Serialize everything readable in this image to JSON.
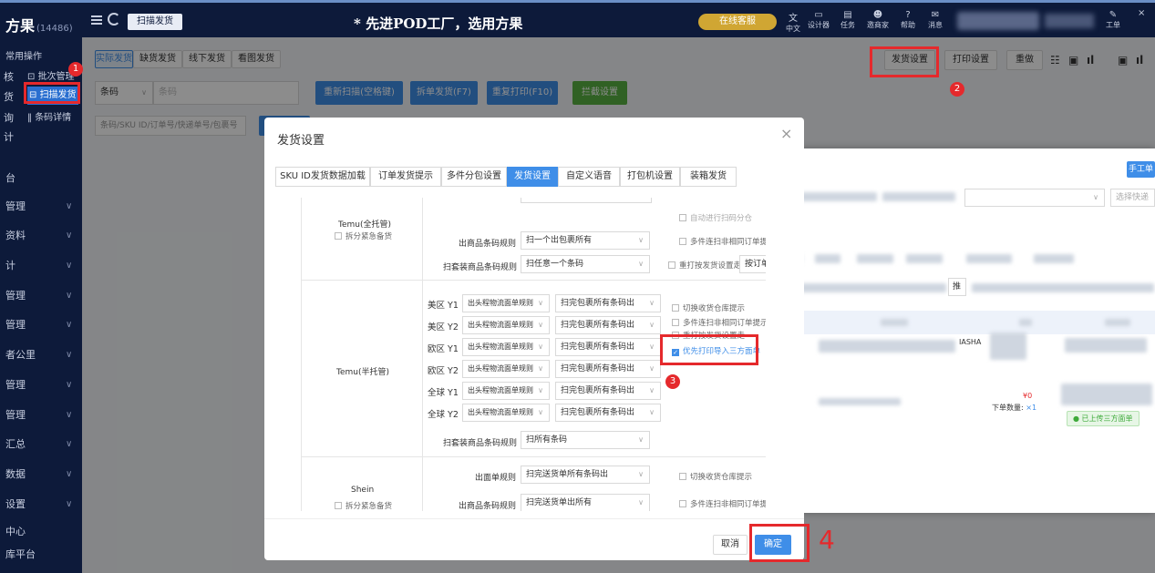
{
  "topbar": {
    "app_name": "方果",
    "app_count": "(14486)",
    "page_tab": "扫描发货",
    "slogan": "* 先进POD工厂，选用方果",
    "promo": "在线客服",
    "icons": [
      {
        "name": "translate-icon",
        "label": "中文"
      },
      {
        "name": "designer-icon",
        "label": "设计器"
      },
      {
        "name": "task-icon",
        "label": "任务"
      },
      {
        "name": "invite-icon",
        "label": "邀商家"
      },
      {
        "name": "help-icon",
        "label": "帮助"
      },
      {
        "name": "message-icon",
        "label": "消息"
      }
    ],
    "workorder": "工单"
  },
  "sidebar": {
    "items": [
      {
        "label": "常用操作"
      },
      {
        "label": "核"
      },
      {
        "label": "货"
      },
      {
        "label": "询"
      },
      {
        "label": "计"
      },
      {
        "label": "台"
      },
      {
        "label": "管理"
      },
      {
        "label": "资料"
      },
      {
        "label": "计"
      },
      {
        "label": "管理"
      },
      {
        "label": "管理"
      },
      {
        "label": "者公里"
      },
      {
        "label": "管理"
      },
      {
        "label": "管理"
      },
      {
        "label": "汇总"
      },
      {
        "label": "数据"
      },
      {
        "label": "设置"
      },
      {
        "label": "中心"
      },
      {
        "label": "库平台"
      }
    ],
    "sub": {
      "batch": "批次管理",
      "scan": "扫描发货",
      "barcode": "条码详情"
    }
  },
  "main": {
    "tabs": [
      "实际发货",
      "缺货发货",
      "线下发货",
      "看图发货"
    ],
    "barcode_select": "条码",
    "barcode_placeholder": "条码",
    "rescan": "重新扫描(空格键)",
    "split": "拆单发货(F7)",
    "reprint": "重复打印(F10)",
    "intercept": "拦截设置",
    "search_placeholder": "条码/SKU ID/订单号/快递单号/包裹号",
    "ship_settings": "发货设置",
    "print_settings": "打印设置",
    "redo": "重做"
  },
  "modal": {
    "title": "发货设置",
    "tabs": [
      "SKU ID发货数据加载",
      "订单发货提示",
      "多件分包设置",
      "发货设置",
      "自定义语音",
      "打包机设置",
      "装箱发货"
    ],
    "active_tab": 3,
    "sections": {
      "temu_full": {
        "name": "Temu(全托管)",
        "urgent": "拆分紧急备货",
        "row1_label": "出商品条码规则",
        "row1_value": "扫一个出包裹所有",
        "row2_label": "扫套装商品条码规则",
        "row2_value": "扫任意一个条码",
        "chk_auto": "自动进行扫码分仓",
        "chk_multi": "多件连扫非相同订单提示",
        "chk_reprint": "重打按发货设置走",
        "reprint_value": "按订单"
      },
      "temu_semi": {
        "name": "Temu(半托管)",
        "rows": [
          {
            "label": "美区 Y1",
            "left": "出头程物流面单规则",
            "right": "扫完包裹所有条码出"
          },
          {
            "label": "美区 Y2",
            "left": "出头程物流面单规则",
            "right": "扫完包裹所有条码出"
          },
          {
            "label": "欧区 Y1",
            "left": "出头程物流面单规则",
            "right": "扫完包裹所有条码出"
          },
          {
            "label": "欧区 Y2",
            "left": "出头程物流面单规则",
            "right": "扫完包裹所有条码出"
          },
          {
            "label": "全球 Y1",
            "left": "出头程物流面单规则",
            "right": "扫完包裹所有条码出"
          },
          {
            "label": "全球 Y2",
            "left": "出头程物流面单规则",
            "right": "扫完包裹所有条码出"
          }
        ],
        "set_label": "扫套装商品条码规则",
        "set_value": "扫所有条码",
        "chk_warehouse": "切换收货仓库提示",
        "chk_multi": "多件连扫非相同订单提示",
        "chk_reprint": "重打按发货设置走",
        "chk_priority": "优先打印导入三方面单"
      },
      "shein": {
        "name": "Shein",
        "urgent": "拆分紧急备货",
        "row1_label": "出面单规则",
        "row1_value": "扫完送货单所有条码出",
        "row2_label": "出商品条码规则",
        "row2_value": "扫完送货单出所有",
        "chk_warehouse": "切换收货仓库提示",
        "chk_multi": "多件连扫非相同订单提示"
      }
    },
    "cancel": "取消",
    "confirm": "确定"
  },
  "right_window": {
    "manual_btn": "手工单",
    "select_express": "选择快递",
    "push": "推",
    "ashap": "IASHA",
    "price": "¥0",
    "qty_label": "下单数量:",
    "qty_value": "×1",
    "uploaded": "已上传三方面单"
  },
  "annotations": [
    "1",
    "2",
    "3",
    "4"
  ]
}
